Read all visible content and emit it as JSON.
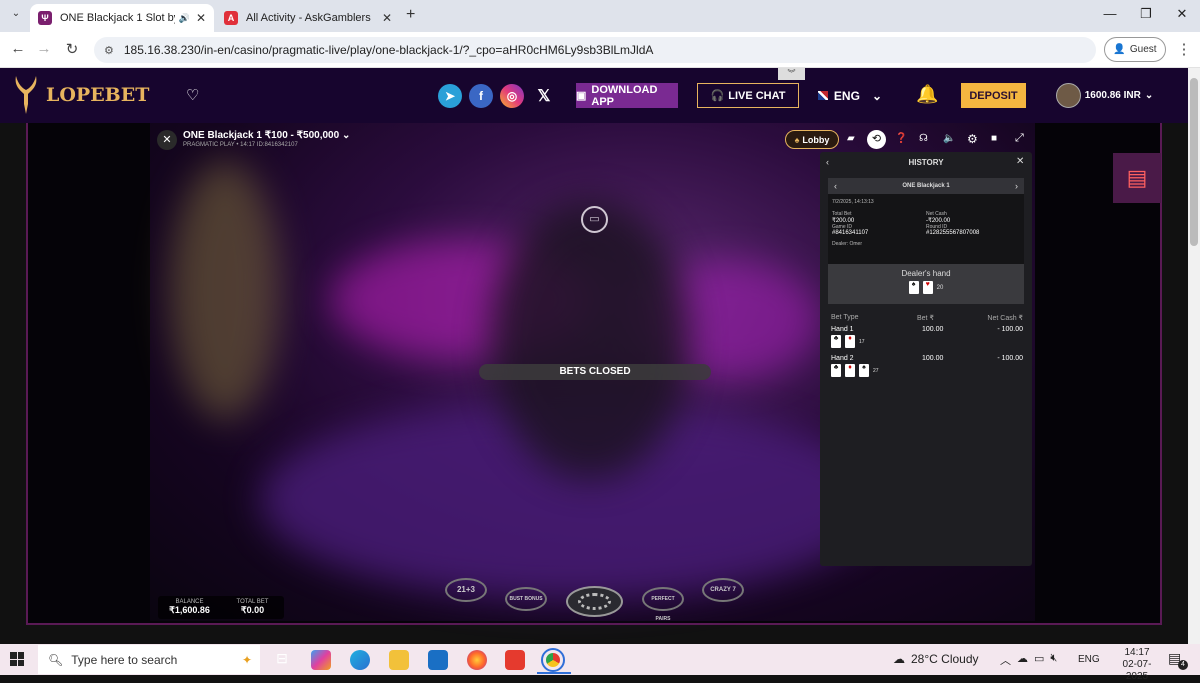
{
  "browser": {
    "tabs": [
      {
        "title": "ONE Blackjack 1 Slot by Pra",
        "favicon_color": "#7a1f6e",
        "active": true
      },
      {
        "title": "All Activity - AskGamblers",
        "favicon_color": "#e0303a",
        "active": false
      }
    ],
    "new_tab_label": "+",
    "url": "185.16.38.230/in-en/casino/pragmatic-live/play/one-blackjack-1/?_cpo=aHR0cHM6Ly9sb3BlLmJldA",
    "profile_label": "Guest"
  },
  "site": {
    "logo_text": "LOPEBET",
    "download_label": "DOWNLOAD APP",
    "live_chat_label": "LIVE CHAT",
    "language": "ENG",
    "deposit_label": "DEPOSIT",
    "balance": "1600.86 INR",
    "brand_color": "#e7b45e"
  },
  "game": {
    "title": "ONE Blackjack 1 ₹100 - ₹500,000",
    "subtitle": "PRAGMATIC PLAY • 14:17 ID:8416342107",
    "lobby_label": "Lobby",
    "status": "BETS CLOSED",
    "balance_label": "BALANCE",
    "balance_value": "₹1,600.86",
    "total_bet_label": "TOTAL BET",
    "total_bet_value": "₹0.00",
    "side_bets": [
      "21+3",
      "BUST BONUS",
      "",
      "PERFECT PAIRS",
      "CRAZY 7"
    ]
  },
  "history": {
    "title": "HISTORY",
    "game_name": "ONE Blackjack 1",
    "datetime": "7/2/2025, 14:13:13",
    "total_bet_label": "Total Bet",
    "total_bet": "₹200.00",
    "net_cash_label": "Net Cash",
    "net_cash": "-₹200.00",
    "game_id_label": "Game ID",
    "game_id": "#8416341107",
    "round_id_label": "Round ID",
    "round_id": "#128255567807008",
    "dealer": "Dealer: Omer",
    "dealers_hand_label": "Dealer's hand",
    "dealers_hand_value": "20",
    "col_bet_type": "Bet Type",
    "col_bet": "Bet ₹",
    "col_net_cash": "Net Cash ₹",
    "rows": [
      {
        "type": "Hand 1",
        "bet": "100.00",
        "net": "- 100.00",
        "total": "17"
      },
      {
        "type": "Hand 2",
        "bet": "100.00",
        "net": "- 100.00",
        "total": "27"
      }
    ]
  },
  "taskbar": {
    "search_placeholder": "Type here to search",
    "weather": "28°C  Cloudy",
    "lang": "ENG",
    "time": "14:17",
    "date": "02-07-2025",
    "notifications": "4"
  }
}
